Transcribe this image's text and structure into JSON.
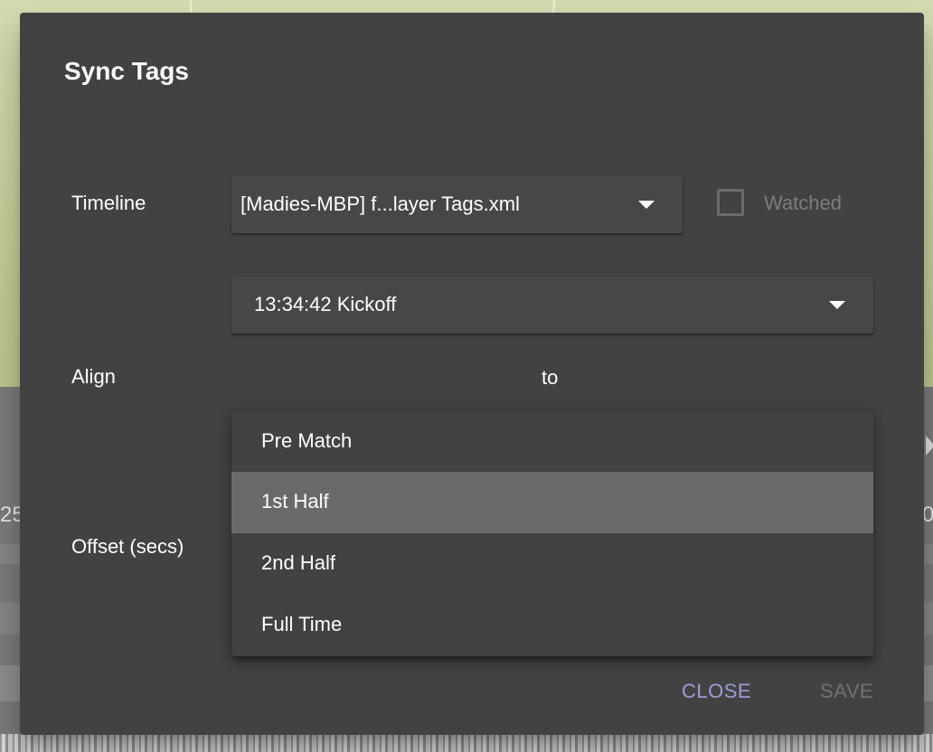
{
  "dialog": {
    "title": "Sync Tags",
    "timeline": {
      "label": "Timeline",
      "selected_value": "[Madies-MBP] f...layer Tags.xml",
      "watched_label": "Watched",
      "watched_checked": false
    },
    "align": {
      "label": "Align",
      "source_value": "13:34:42 Kickoff",
      "to_label": "to",
      "target_options": [
        "Pre Match",
        "1st Half",
        "2nd Half",
        "Full Time"
      ],
      "highlighted_option": "1st Half"
    },
    "offset": {
      "label": "Offset (secs)"
    },
    "actions": {
      "close_label": "CLOSE",
      "save_label": "SAVE"
    }
  },
  "background": {
    "edge_text_left": "25",
    "edge_text_right": "0"
  },
  "colors": {
    "dialog_bg": "#424242",
    "close_accent": "#9c9dd8",
    "disabled_text": "#717171",
    "menu_highlight": "#6a6a6a"
  },
  "icons": {
    "dropdown": "caret-down-icon",
    "checkbox": "checkbox-empty-icon"
  }
}
